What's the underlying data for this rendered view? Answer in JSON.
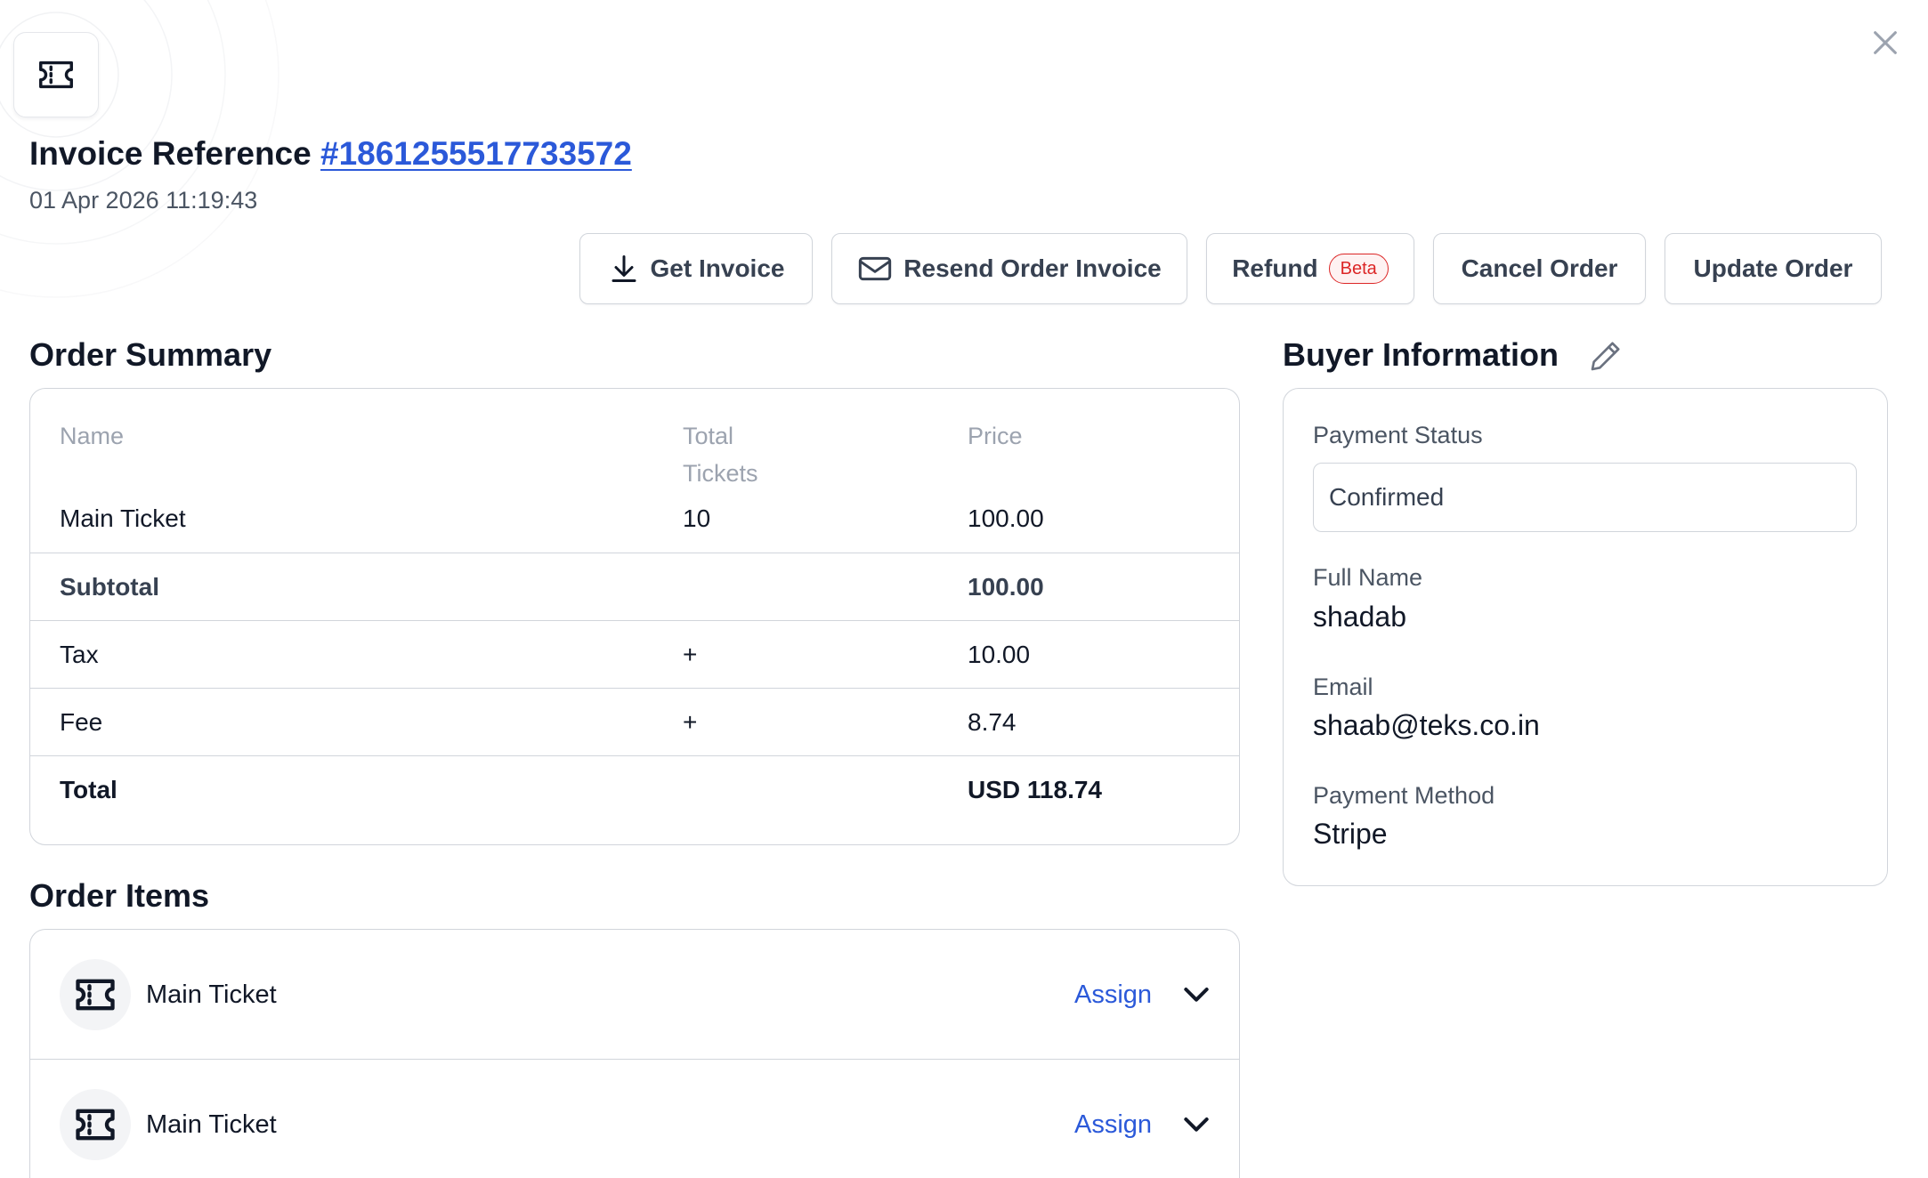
{
  "header": {
    "title_prefix": "Invoice Reference",
    "reference": "#1861255517733572",
    "timestamp": "01 Apr 2026 11:19:43"
  },
  "actions": {
    "get_invoice": "Get Invoice",
    "resend_invoice": "Resend Order Invoice",
    "refund": "Refund",
    "refund_badge": "Beta",
    "cancel_order": "Cancel Order",
    "update_order": "Update Order"
  },
  "summary": {
    "title": "Order Summary",
    "columns": {
      "name": "Name",
      "total": "Total",
      "tickets": "Tickets",
      "price": "Price"
    },
    "item": {
      "name": "Main Ticket",
      "qty": "10",
      "price": "100.00"
    },
    "subtotal": {
      "label": "Subtotal",
      "value": "100.00"
    },
    "tax": {
      "label": "Tax",
      "sign": "+",
      "value": "10.00"
    },
    "fee": {
      "label": "Fee",
      "sign": "+",
      "value": "8.74"
    },
    "total": {
      "label": "Total",
      "value": "USD 118.74"
    }
  },
  "buyer": {
    "title": "Buyer Information",
    "payment_status_label": "Payment Status",
    "payment_status_value": "Confirmed",
    "full_name_label": "Full Name",
    "full_name_value": "shadab",
    "email_label": "Email",
    "email_value": "shaab@teks.co.in",
    "payment_method_label": "Payment Method",
    "payment_method_value": "Stripe"
  },
  "items": {
    "title": "Order Items",
    "list": [
      {
        "name": "Main Ticket",
        "action": "Assign"
      },
      {
        "name": "Main Ticket",
        "action": "Assign"
      }
    ]
  },
  "icons": {
    "ticket": "ticket-icon",
    "close": "close-icon",
    "download": "download-icon",
    "mail": "mail-icon",
    "edit": "pencil-icon",
    "chevron": "chevron-down-icon"
  },
  "colors": {
    "link": "#2b59d9",
    "border": "#d1d5db",
    "beta": "#dc2626"
  }
}
